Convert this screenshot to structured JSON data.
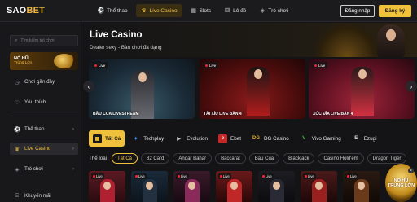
{
  "header": {
    "logo_main": "SAO",
    "logo_accent": "BET",
    "nav": [
      {
        "label": "Thể thao",
        "icon": "soccer-ball-icon"
      },
      {
        "label": "Live Casino",
        "icon": "dealer-icon",
        "active": true
      },
      {
        "label": "Slots",
        "icon": "slot-machine-icon"
      },
      {
        "label": "Lô đề",
        "icon": "dice-icon"
      },
      {
        "label": "Trò chơi",
        "icon": "gamepad-icon"
      }
    ],
    "login_label": "Đăng nhập",
    "register_label": "Đăng ký"
  },
  "sidebar": {
    "search_placeholder": "Tìm kiếm trò chơi",
    "promo_title": "NỔ HŨ",
    "promo_sub": "Trúng Lớn",
    "items": [
      {
        "label": "Chơi gần đây",
        "icon": "history-icon"
      },
      {
        "label": "Yêu thích",
        "icon": "heart-icon"
      },
      {
        "label": "Thể thao",
        "icon": "soccer-ball-icon",
        "chevron": true
      },
      {
        "label": "Live Casino",
        "icon": "dealer-icon",
        "chevron": true,
        "active": true
      },
      {
        "label": "Trò chơi",
        "icon": "gamepad-icon",
        "chevron": true
      },
      {
        "label": "Khuyến mãi",
        "icon": "gift-icon"
      }
    ]
  },
  "hero": {
    "title": "Live Casino",
    "subtitle": "Dealer sexy - Bàn chơi đa dạng"
  },
  "banners": [
    {
      "label": "BẦU CUA LIVESTREAM",
      "live": "Live"
    },
    {
      "label": "TÀI XỈU LIVE BÀN 4",
      "live": "Live"
    },
    {
      "label": "XÓC ĐĨA LIVE BÀN 4",
      "live": "Live"
    }
  ],
  "providers": [
    {
      "label": "Tất Cả",
      "icon": "grid-icon",
      "active": true
    },
    {
      "label": "Techplay",
      "icon": "techplay-logo-icon"
    },
    {
      "label": "Evolution",
      "icon": "evolution-logo-icon"
    },
    {
      "label": "Ebet",
      "icon": "ebet-logo-icon"
    },
    {
      "label": "DG Casino",
      "icon": "dg-casino-logo-icon"
    },
    {
      "label": "Vivo Gaming",
      "icon": "vivo-gaming-logo-icon"
    },
    {
      "label": "Ezugi",
      "icon": "ezugi-logo-icon"
    }
  ],
  "categories": {
    "label": "Thể loại",
    "items": [
      "Tất Cả",
      "32 Card",
      "Andar Bahar",
      "Baccarat",
      "Bầu Cua",
      "Blackjack",
      "Casino Hold'em",
      "Dragon Tiger"
    ]
  },
  "tiles_live": "Live",
  "fab": {
    "line1": "NỔ HŨ",
    "line2": "TRÚNG LỚN"
  },
  "colors": {
    "accent": "#f0c13b",
    "background": "#141416",
    "live": "#e22233"
  }
}
